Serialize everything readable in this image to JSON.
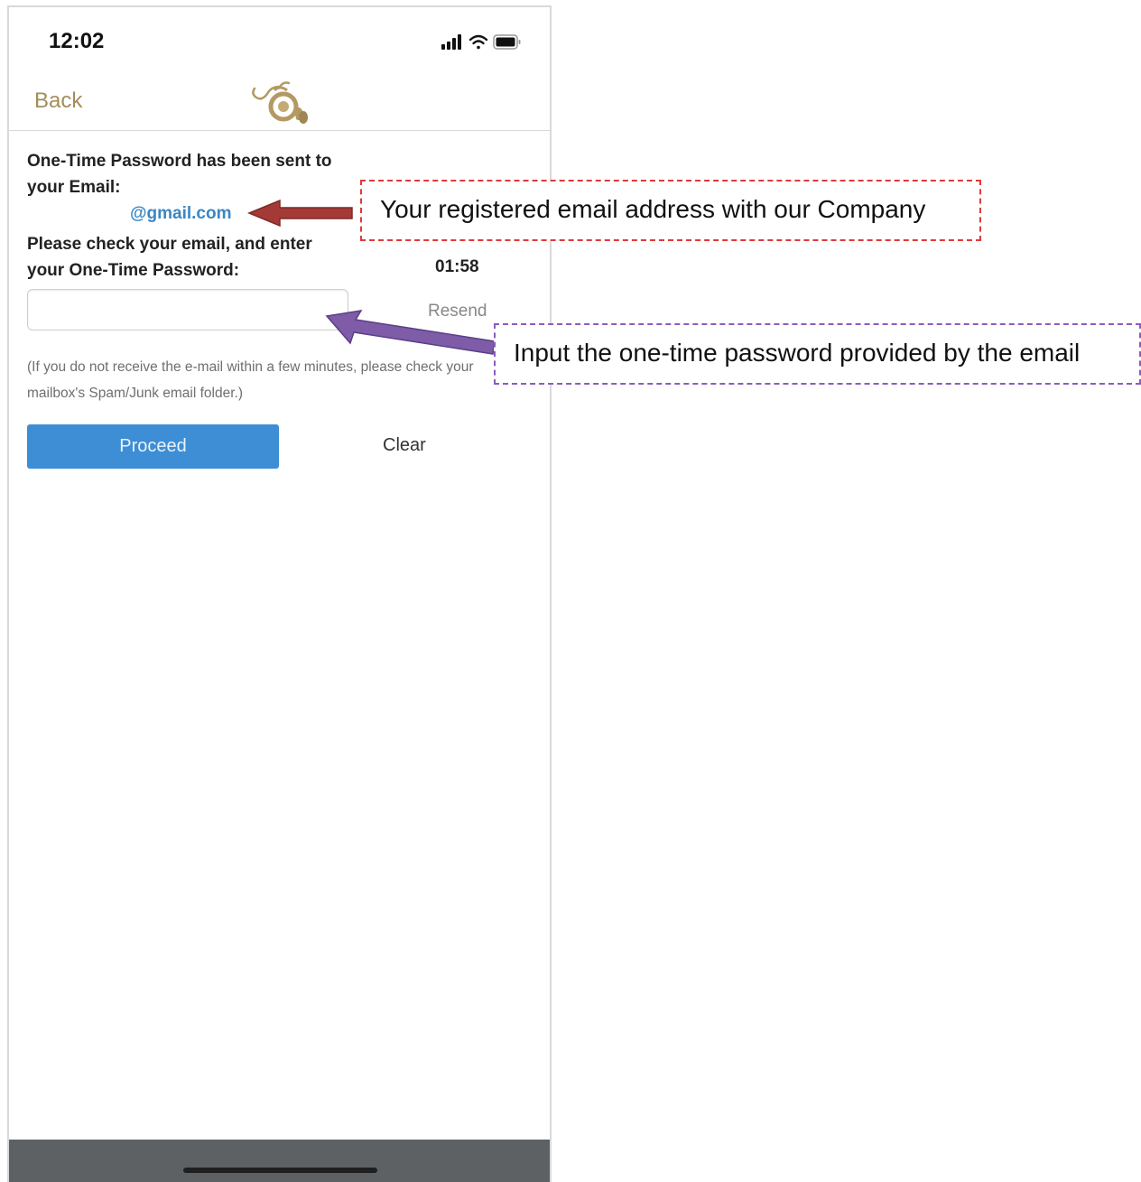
{
  "status_bar": {
    "time": "12:02",
    "icons": [
      "signal-icon",
      "wifi-icon",
      "battery-icon"
    ]
  },
  "nav": {
    "back_label": "Back",
    "logo_icon": "dragon-logo-icon"
  },
  "otp": {
    "message_line1": "One-Time Password has been sent to your Email:",
    "email": "@gmail.com",
    "message_line2": "Please check your email, and enter your One-Time Password:",
    "timer": "01:58",
    "input_value": "",
    "input_placeholder": "",
    "resend_label": "Resend",
    "note": "(If you do not receive the e-mail within a few minutes, please check your mailbox's Spam/Junk email folder.)",
    "proceed_label": "Proceed",
    "clear_label": "Clear"
  },
  "annotations": {
    "email_callout": "Your registered email address with our Company",
    "otp_callout": "Input the one-time password provided by the email"
  },
  "colors": {
    "accent_gold": "#a38d5a",
    "email_blue": "#3b87c4",
    "button_blue": "#3d8ed4",
    "callout_red": "#e03a3a",
    "callout_purple": "#8a5cc0",
    "arrow_red": "#a33a36",
    "arrow_purple": "#7e5ca8"
  }
}
